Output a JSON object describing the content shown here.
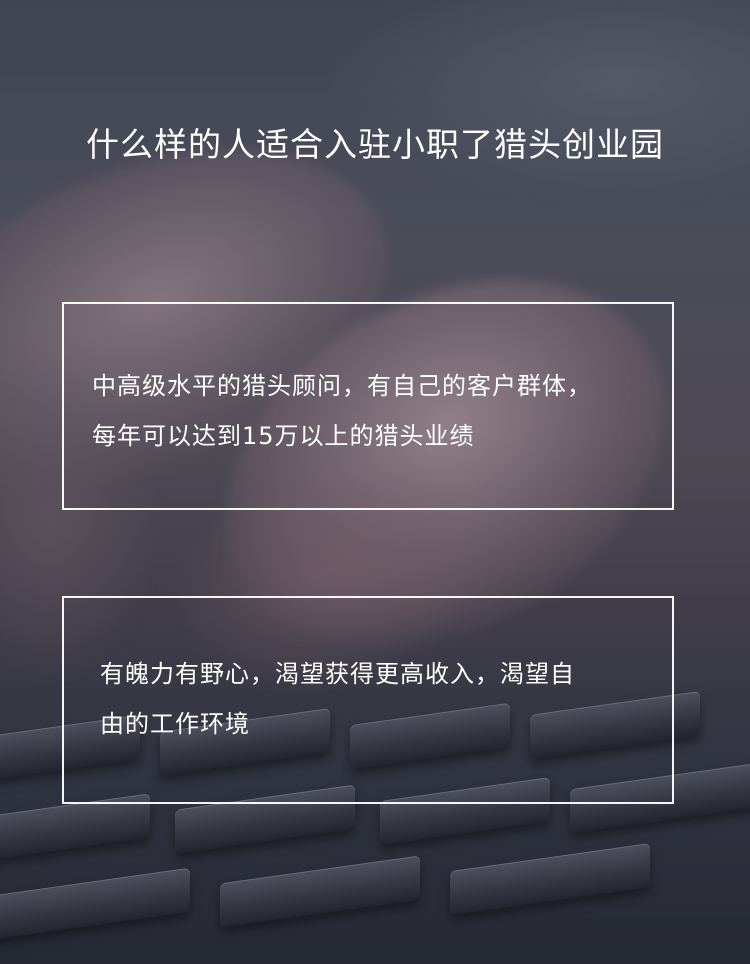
{
  "header": {
    "title": "什么样的人适合入驻小职了猎头创业园"
  },
  "cards": [
    {
      "line1": "中高级水平的猎头顾问，有自己的客户群体，",
      "line2": "每年可以达到15万以上的猎头业绩"
    },
    {
      "line1": "有魄力有野心，渴望获得更高收入，渴望自",
      "line2": "由的工作环境"
    }
  ],
  "background": {
    "image": "hand-typing-on-keyboard-photo",
    "overlay_color": "#2e303c"
  }
}
